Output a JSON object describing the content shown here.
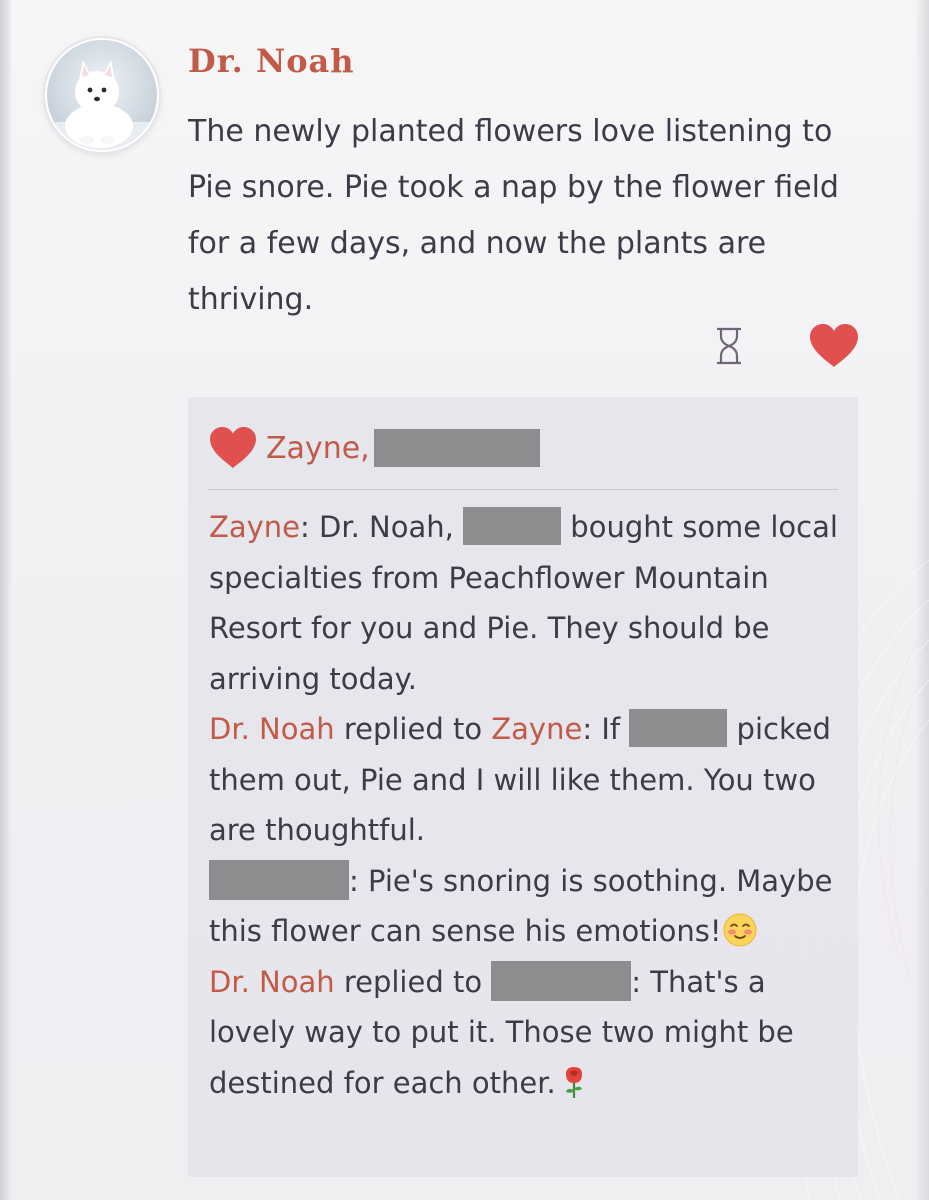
{
  "post": {
    "author": "Dr. Noah",
    "text": "The newly planted flowers love listening to Pie snore. Pie took a nap by the flower field for a few days, and now the plants are thriving.",
    "avatar_icon": "samoyed-dog-avatar"
  },
  "actions": {
    "hourglass_icon": "hourglass-icon",
    "like_icon": "heart-icon",
    "like_color": "#e0504f"
  },
  "likes": {
    "names": "Zayne,",
    "icon": "heart-icon"
  },
  "comments": [
    {
      "author": "Zayne",
      "sep": ": Dr. Noah, ",
      "text": " bought some local specialties from Peachflower Mountain Resort for you and Pie. They should be arriving today."
    },
    {
      "author": "Dr. Noah",
      "replied_to_text": " replied to ",
      "target": "Zayne",
      "text_before": ": If ",
      "text_after": " picked them out, Pie and I will like them. You two are thoughtful."
    },
    {
      "text": ": Pie's snoring is soothing. Maybe this flower can sense his emotions!",
      "emoji": "blushing-face-emoji"
    },
    {
      "author": "Dr. Noah",
      "replied_to_text": " replied to ",
      "text": ": That's a lovely way to put it. Those two might be destined for each other.",
      "emoji": "rose-emoji"
    }
  ],
  "colors": {
    "name_accent": "#c25a48",
    "body_text": "#3f3a48",
    "card_background": "#e3e3ea",
    "redaction": "#8d8d8f"
  }
}
